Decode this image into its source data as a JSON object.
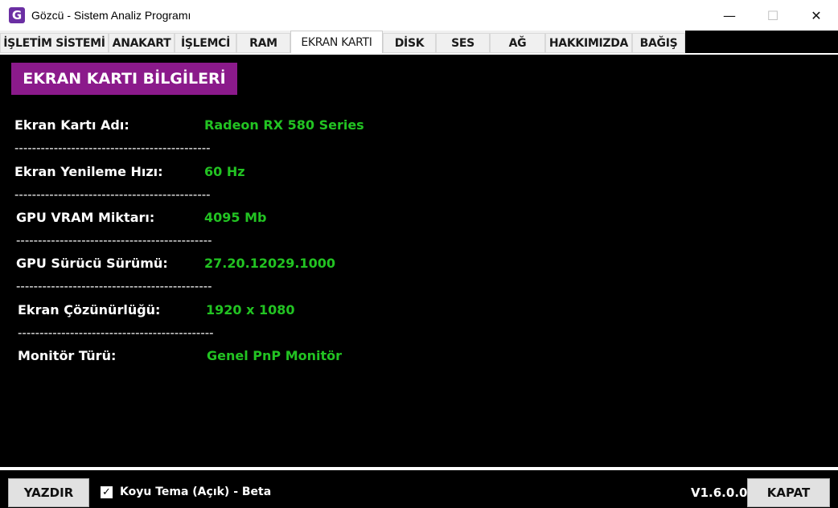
{
  "window": {
    "icon_letter": "G",
    "title": "Gözcü - Sistem Analiz Programı",
    "minimize_glyph": "—",
    "maximize_glyph": "☐",
    "close_glyph": "✕"
  },
  "tabs": [
    {
      "label": "İŞLETİM SİSTEMİ"
    },
    {
      "label": "ANAKART"
    },
    {
      "label": "İŞLEMCİ"
    },
    {
      "label": "RAM"
    },
    {
      "label": "EKRAN KARTI",
      "active": true
    },
    {
      "label": "DİSK"
    },
    {
      "label": "SES"
    },
    {
      "label": "AĞ"
    },
    {
      "label": "HAKKIMIZDA"
    },
    {
      "label": "BAĞIŞ"
    }
  ],
  "section": {
    "title": "EKRAN KARTI BİLGİLERİ"
  },
  "rows": [
    {
      "label": "Ekran Kartı Adı:",
      "value": "Radeon RX 580 Series"
    },
    {
      "label": "Ekran Yenileme Hızı:",
      "value": "60 Hz"
    },
    {
      "label": "GPU VRAM Miktarı:",
      "value": "4095 Mb"
    },
    {
      "label": "GPU Sürücü Sürümü:",
      "value": "27.20.12029.1000"
    },
    {
      "label": "Ekran Çözünürlüğü:",
      "value": "1920 x 1080"
    },
    {
      "label": "Monitör Türü:",
      "value": "Genel PnP Monitör"
    }
  ],
  "separator": "---------------------------------------------",
  "footer": {
    "print_label": "YAZDIR",
    "dark_theme_checked": true,
    "dark_theme_label": "Koyu Tema (Açık) - Beta",
    "version": "V1.6.0.0",
    "close_label": "KAPAT"
  },
  "colors": {
    "header_bg": "#8b1a8b",
    "value_text": "#22c322",
    "background": "#000000"
  }
}
